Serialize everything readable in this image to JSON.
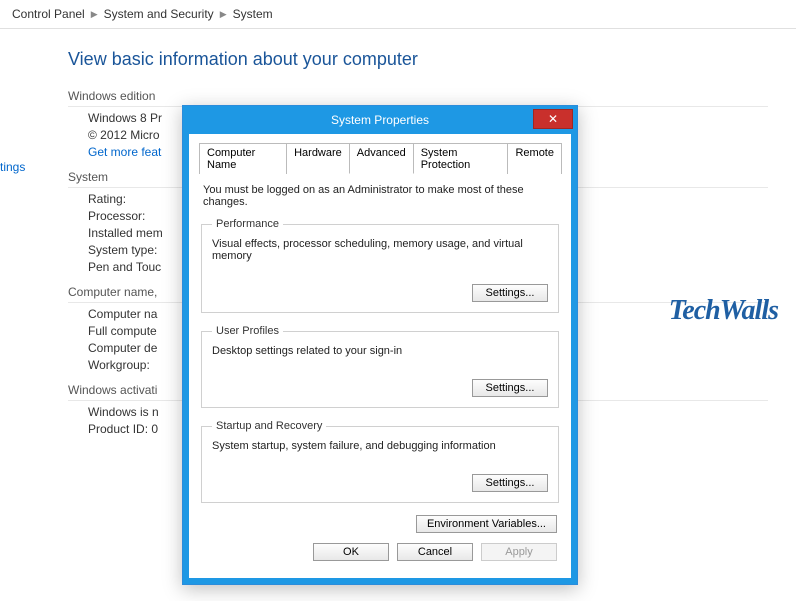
{
  "breadcrumb": {
    "a": "Control Panel",
    "b": "System and Security",
    "c": "System"
  },
  "page_title": "View basic information about your computer",
  "sidelink": "tings",
  "sections": {
    "edition": {
      "head": "Windows edition",
      "r1": "Windows 8 Pr",
      "r2": "© 2012 Micro",
      "link": "Get more feat"
    },
    "system": {
      "head": "System",
      "r1": "Rating:",
      "r2": "Processor:",
      "r3": "Installed mem",
      "r4": "System type:",
      "r5": "Pen and Touc"
    },
    "computer": {
      "head": "Computer name,",
      "r1": "Computer na",
      "r2": "Full compute",
      "r3": "Computer de",
      "r4": "Workgroup:"
    },
    "activation": {
      "head": "Windows activati",
      "r1": "Windows is n",
      "r2": "Product ID: 0"
    }
  },
  "watermark": "TechWalls",
  "dialog": {
    "title": "System Properties",
    "tabs": {
      "t1": "Computer Name",
      "t2": "Hardware",
      "t3": "Advanced",
      "t4": "System Protection",
      "t5": "Remote"
    },
    "info": "You must be logged on as an Administrator to make most of these changes.",
    "perf": {
      "legend": "Performance",
      "desc": "Visual effects, processor scheduling, memory usage, and virtual memory",
      "btn": "Settings..."
    },
    "prof": {
      "legend": "User Profiles",
      "desc": "Desktop settings related to your sign-in",
      "btn": "Settings..."
    },
    "startup": {
      "legend": "Startup and Recovery",
      "desc": "System startup, system failure, and debugging information",
      "btn": "Settings..."
    },
    "env": "Environment Variables...",
    "footer": {
      "ok": "OK",
      "cancel": "Cancel",
      "apply": "Apply"
    }
  }
}
